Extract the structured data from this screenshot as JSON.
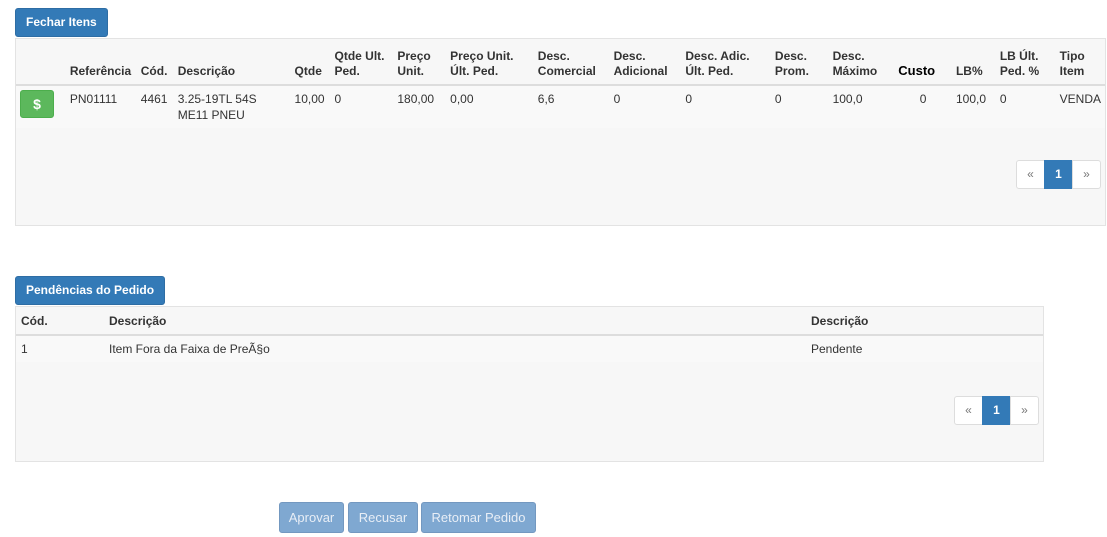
{
  "fechar_itens": {
    "title": "Fechar Itens",
    "headers": {
      "referencia": "Referência",
      "cod": "Cód.",
      "descricao": "Descrição",
      "qtde": "Qtde",
      "qtde_ult_ped_1": "Qtde Ult.",
      "qtde_ult_ped_2": "Ped.",
      "preco_unit_1": "Preço",
      "preco_unit_2": "Unit.",
      "preco_unit_ult_1": "Preço Unit.",
      "preco_unit_ult_2": "Últ. Ped.",
      "desc_comercial_1": "Desc.",
      "desc_comercial_2": "Comercial",
      "desc_adicional_1": "Desc.",
      "desc_adicional_2": "Adicional",
      "desc_adic_ult_1": "Desc. Adic.",
      "desc_adic_ult_2": "Últ. Ped.",
      "desc_prom_1": "Desc.",
      "desc_prom_2": "Prom.",
      "desc_max_1": "Desc.",
      "desc_max_2": "Máximo",
      "custo": "Custo",
      "lb": "LB%",
      "lb_ult_1": "LB Últ.",
      "lb_ult_2": "Ped. %",
      "tipo_1": "Tipo",
      "tipo_2": "Item"
    },
    "rows": [
      {
        "action_symbol": "$",
        "referencia": "PN01111",
        "cod": "4461",
        "descricao_1": "3.25-19TL 54S",
        "descricao_2": "ME11 PNEU",
        "qtde": "10,00",
        "qtde_ult_ped": "0",
        "preco_unit": "180,00",
        "preco_unit_ult": "0,00",
        "desc_comercial": "6,6",
        "desc_adicional": "0",
        "desc_adic_ult": "0",
        "desc_prom": "0",
        "desc_max": "100,0",
        "custo": "0",
        "lb": "100,0",
        "lb_ult": "0",
        "tipo": "VENDA"
      }
    ],
    "pagination": {
      "prev": "«",
      "current": "1",
      "next": "»"
    }
  },
  "pendencias": {
    "title": "Pendências do Pedido",
    "headers": {
      "cod": "Cód.",
      "descricao": "Descrição",
      "status": "Descrição"
    },
    "rows": [
      {
        "cod": "1",
        "descricao": "Item Fora da Faixa de PreÃ§o",
        "status": "Pendente"
      }
    ],
    "pagination": {
      "prev": "«",
      "current": "1",
      "next": "»"
    }
  },
  "actions": {
    "aprovar": "Aprovar",
    "recusar": "Recusar",
    "retomar": "Retomar Pedido"
  },
  "colors": {
    "primary": "#337ab7",
    "success": "#5cb85c",
    "disabled": "#7fa8d1"
  }
}
